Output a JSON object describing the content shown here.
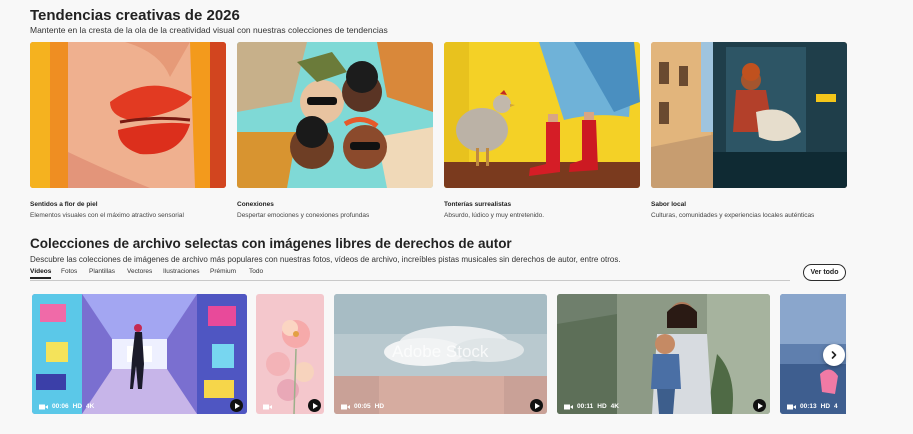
{
  "trends": {
    "title": "Tendencias creativas de 2026",
    "subtitle": "Mantente en la cresta de la ola de la creatividad visual con nuestras colecciones de tendencias",
    "cards": [
      {
        "title": "Sentidos a flor de piel",
        "desc": "Elementos visuales con el máximo atractivo sensorial"
      },
      {
        "title": "Conexiones",
        "desc": "Despertar emociones y conexiones profundas"
      },
      {
        "title": "Tonterías surrealistas",
        "desc": "Absurdo, lúdico y muy entretenido."
      },
      {
        "title": "Sabor local",
        "desc": "Culturas, comunidades y experiencias locales auténticas"
      }
    ]
  },
  "archive": {
    "title": "Colecciones de archivo selectas con imágenes libres de derechos de autor",
    "subtitle": "Descubre las colecciones de imágenes de archivo más populares con nuestras fotos, vídeos de archivo, increíbles pistas musicales sin derechos de autor, entre otros.",
    "tabs": [
      "Vídeos",
      "Fotos",
      "Plantillas",
      "Vectores",
      "Ilustraciones",
      "Prémium",
      "Todo"
    ],
    "see_all": "Ver todo",
    "videos": [
      {
        "duration": "00:06",
        "quality": "HD",
        "res": "4K"
      },
      {
        "duration": "",
        "quality": "",
        "res": ""
      },
      {
        "duration": "00:05",
        "quality": "HD",
        "res": ""
      },
      {
        "duration": "00:11",
        "quality": "HD",
        "res": "4K"
      },
      {
        "duration": "00:13",
        "quality": "HD",
        "res": "4"
      }
    ],
    "watermark": "Adobe Stock"
  }
}
